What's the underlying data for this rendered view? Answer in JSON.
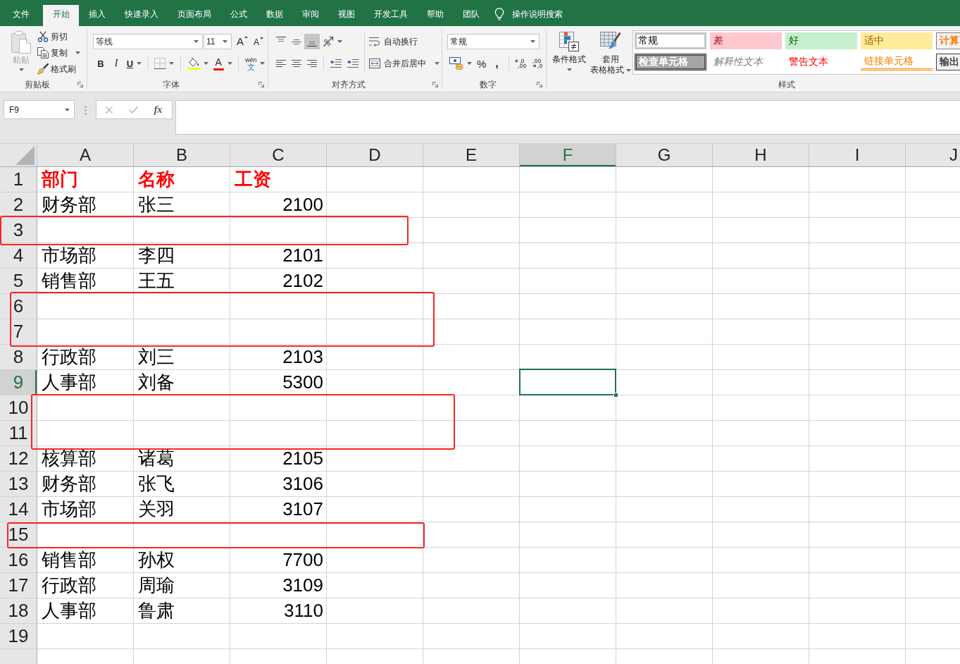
{
  "tabs": [
    {
      "label": "文件",
      "selected": false
    },
    {
      "label": "开始",
      "selected": true
    },
    {
      "label": "插入",
      "selected": false
    },
    {
      "label": "快速录入",
      "selected": false
    },
    {
      "label": "页面布局",
      "selected": false
    },
    {
      "label": "公式",
      "selected": false
    },
    {
      "label": "数据",
      "selected": false
    },
    {
      "label": "审阅",
      "selected": false
    },
    {
      "label": "视图",
      "selected": false
    },
    {
      "label": "开发工具",
      "selected": false
    },
    {
      "label": "帮助",
      "selected": false
    },
    {
      "label": "团队",
      "selected": false
    }
  ],
  "tell_me": {
    "label": "操作说明搜索"
  },
  "ribbon": {
    "groups": [
      {
        "kind": "clipboard",
        "label": "剪贴板",
        "launcher": true,
        "paste": {
          "label": "粘贴",
          "disabled": true,
          "dropdown": true
        },
        "actions": [
          {
            "kind": "cut",
            "label": "剪切",
            "dropdown": false
          },
          {
            "kind": "copy",
            "label": "复制",
            "dropdown": true
          },
          {
            "kind": "painter",
            "label": "格式刷",
            "dropdown": false
          }
        ]
      },
      {
        "kind": "font",
        "label": "字体",
        "launcher": true,
        "font_name": "等线",
        "font_size": "11",
        "size_buttons": [
          {
            "kind": "grow",
            "label": "A"
          },
          {
            "kind": "shrink",
            "label": "A"
          }
        ],
        "tool_sets": [
          [
            {
              "kind": "bold",
              "label": "B",
              "dropdown": false,
              "selected": false
            },
            {
              "kind": "italic",
              "label": "I",
              "dropdown": false,
              "selected": false
            },
            {
              "kind": "underline",
              "label": "U",
              "dropdown": true,
              "selected": false
            }
          ],
          [
            {
              "kind": "borders",
              "dropdown": true,
              "selected": false
            }
          ],
          [
            {
              "kind": "fill",
              "dropdown": true,
              "selected": false,
              "color": "#ffff00"
            },
            {
              "kind": "font_color",
              "label": "A",
              "dropdown": true,
              "selected": false,
              "color": "#ff0000"
            }
          ],
          [
            {
              "kind": "phonetic",
              "label": "wén",
              "sublabel": "文",
              "dropdown": true,
              "selected": false
            }
          ]
        ]
      },
      {
        "kind": "alignment",
        "label": "对齐方式",
        "launcher": true,
        "rows": [
          [
            [
              {
                "kind": "top",
                "dropdown": false,
                "selected": false
              },
              {
                "kind": "middle",
                "dropdown": false,
                "selected": false
              },
              {
                "kind": "bottom",
                "dropdown": false,
                "selected": true
              },
              {
                "kind": "orientation",
                "dropdown": true,
                "selected": false
              }
            ]
          ],
          [
            [
              {
                "kind": "left",
                "dropdown": false,
                "selected": false
              },
              {
                "kind": "center",
                "dropdown": false,
                "selected": false
              },
              {
                "kind": "right",
                "dropdown": false,
                "selected": false
              }
            ],
            [
              {
                "kind": "outdent",
                "dropdown": false,
                "selected": false
              },
              {
                "kind": "indent",
                "dropdown": false,
                "selected": false
              }
            ]
          ]
        ],
        "wide_buttons": [
          {
            "kind": "wrap",
            "label": "自动换行",
            "dropdown": false
          },
          {
            "kind": "merge",
            "label": "合并后居中",
            "dropdown": true
          }
        ]
      },
      {
        "kind": "number",
        "label": "数字",
        "launcher": true,
        "format": "常规",
        "tool_sets": [
          [
            {
              "kind": "accounting",
              "dropdown": true,
              "selected": false
            },
            {
              "kind": "percent",
              "label": "%",
              "dropdown": false,
              "selected": false
            },
            {
              "kind": "comma",
              "label": ",",
              "dropdown": false,
              "selected": false
            }
          ],
          [
            {
              "kind": "more_decimals",
              "dropdown": false,
              "selected": false
            },
            {
              "kind": "fewer_decimals",
              "dropdown": false,
              "selected": false
            }
          ]
        ]
      },
      {
        "kind": "styles",
        "label": "样式",
        "launcher": false,
        "big_buttons": [
          {
            "kind": "conditional",
            "lines": [
              "条件格式"
            ],
            "dropdown": true
          },
          {
            "kind": "table",
            "lines": [
              "套用",
              "表格格式"
            ],
            "dropdown": true
          }
        ],
        "cell_styles": [
          {
            "label": "常规",
            "kind": "normal",
            "selected": true
          },
          {
            "label": "差",
            "kind": "bad",
            "selected": false
          },
          {
            "label": "好",
            "kind": "good",
            "selected": false
          },
          {
            "label": "适中",
            "kind": "neutral",
            "selected": false
          },
          {
            "label": "计算",
            "kind": "calculation",
            "selected": false
          },
          {
            "label": "检查单元格",
            "kind": "check",
            "selected": false
          },
          {
            "label": "解释性文本",
            "kind": "explanatory",
            "selected": false
          },
          {
            "label": "警告文本",
            "kind": "warning",
            "selected": false
          },
          {
            "label": "链接单元格",
            "kind": "linked",
            "selected": false
          },
          {
            "label": "输出",
            "kind": "output",
            "selected": false
          }
        ]
      }
    ]
  },
  "formula_bar": {
    "name_box": "F9",
    "buttons": [
      {
        "kind": "cancel",
        "disabled": true
      },
      {
        "kind": "enter",
        "disabled": true
      },
      {
        "kind": "function",
        "label": "fx",
        "disabled": false
      }
    ]
  },
  "sheet": {
    "columns": [
      {
        "label": "A",
        "selected": false
      },
      {
        "label": "B",
        "selected": false
      },
      {
        "label": "C",
        "selected": false
      },
      {
        "label": "D",
        "selected": false
      },
      {
        "label": "E",
        "selected": false
      },
      {
        "label": "F",
        "selected": true
      },
      {
        "label": "G",
        "selected": false
      },
      {
        "label": "H",
        "selected": false
      },
      {
        "label": "I",
        "selected": false
      },
      {
        "label": "J",
        "selected": false
      }
    ],
    "rows": [
      {
        "label": "1",
        "selected": false,
        "marked": false,
        "cells": [
          {
            "text": "部门",
            "kind": "header"
          },
          {
            "text": "名称",
            "kind": "header"
          },
          {
            "text": "工资",
            "kind": "header"
          }
        ]
      },
      {
        "label": "2",
        "selected": false,
        "marked": false,
        "cells": [
          {
            "text": "财务部",
            "kind": "text"
          },
          {
            "text": "张三",
            "kind": "text"
          },
          {
            "text": "2100",
            "kind": "number"
          }
        ]
      },
      {
        "label": "3",
        "selected": false,
        "marked": true
      },
      {
        "label": "4",
        "selected": false,
        "marked": false,
        "cells": [
          {
            "text": "市场部",
            "kind": "text"
          },
          {
            "text": "李四",
            "kind": "text"
          },
          {
            "text": "2101",
            "kind": "number"
          }
        ]
      },
      {
        "label": "5",
        "selected": false,
        "marked": false,
        "cells": [
          {
            "text": "销售部",
            "kind": "text"
          },
          {
            "text": "王五",
            "kind": "text"
          },
          {
            "text": "2102",
            "kind": "number"
          }
        ]
      },
      {
        "label": "6",
        "selected": false,
        "marked": true
      },
      {
        "label": "7",
        "selected": false,
        "marked": true
      },
      {
        "label": "8",
        "selected": false,
        "marked": false,
        "cells": [
          {
            "text": "行政部",
            "kind": "text"
          },
          {
            "text": "刘三",
            "kind": "text"
          },
          {
            "text": "2103",
            "kind": "number"
          }
        ]
      },
      {
        "label": "9",
        "selected": true,
        "marked": false,
        "cells": [
          {
            "text": "人事部",
            "kind": "text"
          },
          {
            "text": "刘备",
            "kind": "text"
          },
          {
            "text": "5300",
            "kind": "number"
          }
        ]
      },
      {
        "label": "10",
        "selected": false,
        "marked": true
      },
      {
        "label": "11",
        "selected": false,
        "marked": true
      },
      {
        "label": "12",
        "selected": false,
        "marked": false,
        "cells": [
          {
            "text": "核算部",
            "kind": "text"
          },
          {
            "text": "诸葛",
            "kind": "text"
          },
          {
            "text": "2105",
            "kind": "number"
          }
        ]
      },
      {
        "label": "13",
        "selected": false,
        "marked": false,
        "cells": [
          {
            "text": "财务部",
            "kind": "text"
          },
          {
            "text": "张飞",
            "kind": "text"
          },
          {
            "text": "3106",
            "kind": "number"
          }
        ]
      },
      {
        "label": "14",
        "selected": false,
        "marked": false,
        "cells": [
          {
            "text": "市场部",
            "kind": "text"
          },
          {
            "text": "关羽",
            "kind": "text"
          },
          {
            "text": "3107",
            "kind": "number"
          }
        ]
      },
      {
        "label": "15",
        "selected": false,
        "marked": true
      },
      {
        "label": "16",
        "selected": false,
        "marked": false,
        "cells": [
          {
            "text": "销售部",
            "kind": "text"
          },
          {
            "text": "孙权",
            "kind": "text"
          },
          {
            "text": "7700",
            "kind": "number"
          }
        ]
      },
      {
        "label": "17",
        "selected": false,
        "marked": false,
        "cells": [
          {
            "text": "行政部",
            "kind": "text"
          },
          {
            "text": "周瑜",
            "kind": "text"
          },
          {
            "text": "3109",
            "kind": "number"
          }
        ]
      },
      {
        "label": "18",
        "selected": false,
        "marked": false,
        "cells": [
          {
            "text": "人事部",
            "kind": "text"
          },
          {
            "text": "鲁肃",
            "kind": "text"
          },
          {
            "text": "3110",
            "kind": "number"
          }
        ]
      },
      {
        "label": "19",
        "selected": false,
        "marked": false
      },
      {
        "selected": false,
        "marked": false
      }
    ]
  }
}
